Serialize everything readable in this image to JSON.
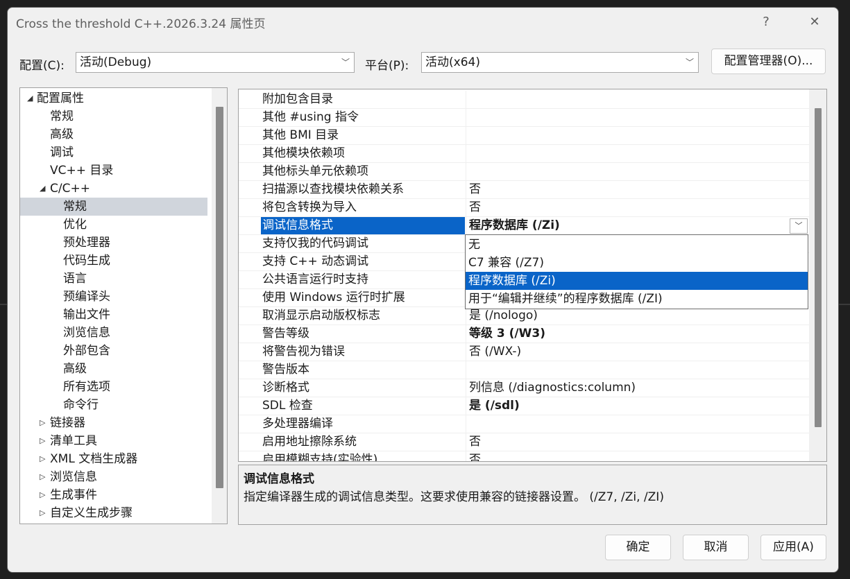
{
  "window": {
    "title": "Cross the threshold C++.2026.3.24 属性页",
    "help_glyph": "?",
    "close_glyph": "✕"
  },
  "config": {
    "config_label": "配置(C):",
    "config_value": "活动(Debug)",
    "platform_label": "平台(P):",
    "platform_value": "活动(x64)",
    "manager_button": "配置管理器(O)..."
  },
  "tree": {
    "items": [
      {
        "label": "配置属性",
        "twisty": "◢"
      },
      {
        "label": "常规"
      },
      {
        "label": "高级"
      },
      {
        "label": "调试"
      },
      {
        "label": "VC++ 目录"
      },
      {
        "label": "C/C++",
        "twisty": "◢"
      },
      {
        "label": "常规"
      },
      {
        "label": "优化"
      },
      {
        "label": "预处理器"
      },
      {
        "label": "代码生成"
      },
      {
        "label": "语言"
      },
      {
        "label": "预编译头"
      },
      {
        "label": "输出文件"
      },
      {
        "label": "浏览信息"
      },
      {
        "label": "外部包含"
      },
      {
        "label": "高级"
      },
      {
        "label": "所有选项"
      },
      {
        "label": "命令行"
      },
      {
        "label": "链接器",
        "twisty": "▷"
      },
      {
        "label": "清单工具",
        "twisty": "▷"
      },
      {
        "label": "XML 文档生成器",
        "twisty": "▷"
      },
      {
        "label": "浏览信息",
        "twisty": "▷"
      },
      {
        "label": "生成事件",
        "twisty": "▷"
      },
      {
        "label": "自定义生成步骤",
        "twisty": "▷"
      }
    ],
    "selected_index": 6
  },
  "grid": {
    "rows": [
      {
        "name": "附加包含目录",
        "value": ""
      },
      {
        "name": "其他 #using 指令",
        "value": ""
      },
      {
        "name": "其他 BMI 目录",
        "value": ""
      },
      {
        "name": "其他模块依赖项",
        "value": ""
      },
      {
        "name": "其他标头单元依赖项",
        "value": ""
      },
      {
        "name": "扫描源以查找模块依赖关系",
        "value": "否"
      },
      {
        "name": "将包含转换为导入",
        "value": "否"
      },
      {
        "name": "调试信息格式",
        "value": "程序数据库 (/Zi)",
        "bold": true,
        "active": true
      },
      {
        "name": "支持仅我的代码调试",
        "value": ""
      },
      {
        "name": "支持 C++ 动态调试",
        "value": ""
      },
      {
        "name": "公共语言运行时支持",
        "value": ""
      },
      {
        "name": "使用 Windows 运行时扩展",
        "value": ""
      },
      {
        "name": "取消显示启动版权标志",
        "value": "是 (/nologo)"
      },
      {
        "name": "警告等级",
        "value": "等级 3 (/W3)",
        "bold": true
      },
      {
        "name": "将警告视为错误",
        "value": "否 (/WX-)"
      },
      {
        "name": "警告版本",
        "value": ""
      },
      {
        "name": "诊断格式",
        "value": "列信息 (/diagnostics:column)"
      },
      {
        "name": "SDL 检查",
        "value": "是 (/sdl)",
        "bold": true
      },
      {
        "name": "多处理器编译",
        "value": ""
      },
      {
        "name": "启用地址擦除系统",
        "value": "否"
      },
      {
        "name": "启用模糊支持(实验性)",
        "value": "否"
      }
    ],
    "dropdown_options": [
      "无",
      "C7 兼容 (/Z7)",
      "程序数据库 (/Zi)",
      "用于“编辑并继续”的程序数据库 (/ZI)"
    ],
    "dropdown_selected": 2
  },
  "description": {
    "title": "调试信息格式",
    "text": "指定编译器生成的调试信息类型。这要求使用兼容的链接器设置。  (/Z7, /Zi, /ZI)"
  },
  "buttons": {
    "ok": "确定",
    "cancel": "取消",
    "apply": "应用(A)"
  },
  "colors": {
    "selection_blue": "#0a64c8",
    "tree_selection": "#d0d5dc",
    "dialog_bg": "#f0f0f0"
  }
}
